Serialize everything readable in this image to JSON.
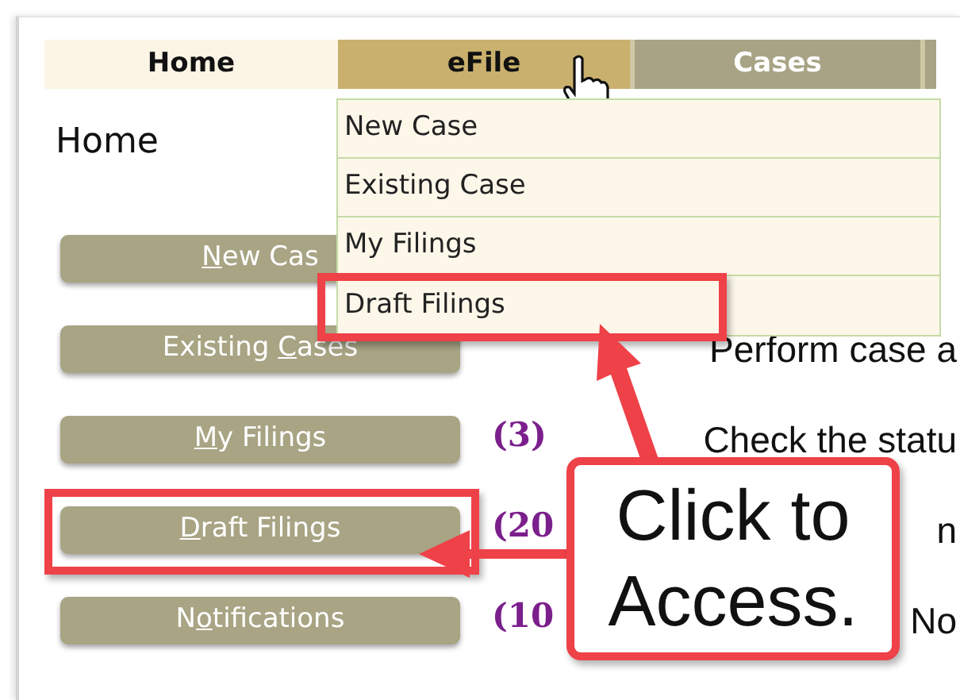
{
  "nav": {
    "tabs": [
      {
        "label": "Home",
        "kind": "home",
        "selected": false
      },
      {
        "label": "eFile",
        "kind": "menu",
        "selected": true
      },
      {
        "label": "Cases",
        "kind": "menu",
        "selected": false
      }
    ]
  },
  "dropdown": {
    "items": [
      {
        "label": "New Case"
      },
      {
        "label": "Existing Case"
      },
      {
        "label": "My Filings"
      },
      {
        "label": "Draft Filings"
      }
    ]
  },
  "heading": "Home",
  "rows": [
    {
      "button": {
        "key": "N",
        "post": "ew Cas"
      }
    },
    {
      "button": {
        "pre": "Existing ",
        "key": "C",
        "post": "ases"
      },
      "description": "Perform case a"
    },
    {
      "button": {
        "key": "M",
        "post": "y Filings"
      },
      "count": "(3)",
      "description": "Check the statu"
    },
    {
      "button": {
        "key": "D",
        "post": "raft Filings"
      },
      "count": "(20",
      "description": "n"
    },
    {
      "button": {
        "pre": "N",
        "key": "o",
        "post": "tifications"
      },
      "count": "(10",
      "description": "No"
    }
  ],
  "callout": {
    "lines": [
      "Click to",
      "Access."
    ]
  }
}
